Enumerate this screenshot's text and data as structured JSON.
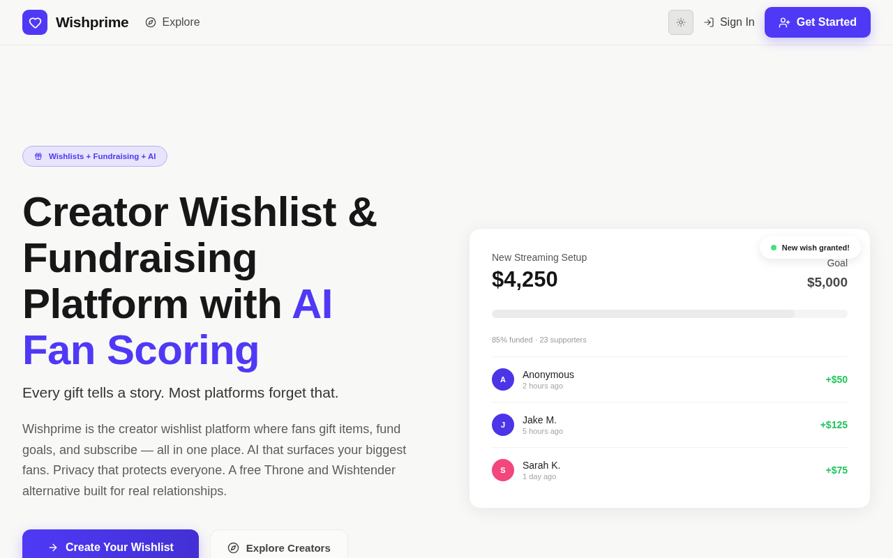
{
  "header": {
    "brand": "Wishprime",
    "nav_links": [
      {
        "label": "Explore"
      }
    ],
    "sign_in": "Sign In",
    "get_started": "Get Started"
  },
  "hero": {
    "badge": "Wishlists + Fundraising + AI",
    "headline": [
      {
        "text": "Creator Wishlist & Fundraising Platform with ",
        "highlighted": false
      },
      {
        "text": "AI Fan Scoring",
        "highlighted": true
      }
    ],
    "tagline": "Every gift tells a story. Most platforms forget that.",
    "description": "Wishprime is the creator wishlist platform where fans gift items, fund goals, and subscribe — all in one place. AI that surfaces your biggest fans. Privacy that protects everyone. A free Throne and Wishtender alternative built for real relationships.",
    "buttons": [
      {
        "label": "Create Your Wishlist",
        "kind": "primary"
      },
      {
        "label": "Explore Creators",
        "kind": "secondary"
      }
    ]
  },
  "wish_card": {
    "toast": "New wish granted!",
    "title": "New Streaming Setup",
    "raised": "$4,250",
    "goal_label": "Goal",
    "goal": "$5,000",
    "progress": {
      "level": 0.85
    },
    "summary": "85% funded · 23 supporters",
    "donations": [
      {
        "initial": "A",
        "color": "#4b35e6",
        "name": "Anonymous",
        "time": "2 hours ago",
        "amount": "+$50"
      },
      {
        "initial": "J",
        "color": "#4b35e6",
        "name": "Jake M.",
        "time": "5 hours ago",
        "amount": "+$125"
      },
      {
        "initial": "S",
        "color": "#f2477d",
        "name": "Sarah K.",
        "time": "1 day ago",
        "amount": "+$75"
      }
    ]
  }
}
